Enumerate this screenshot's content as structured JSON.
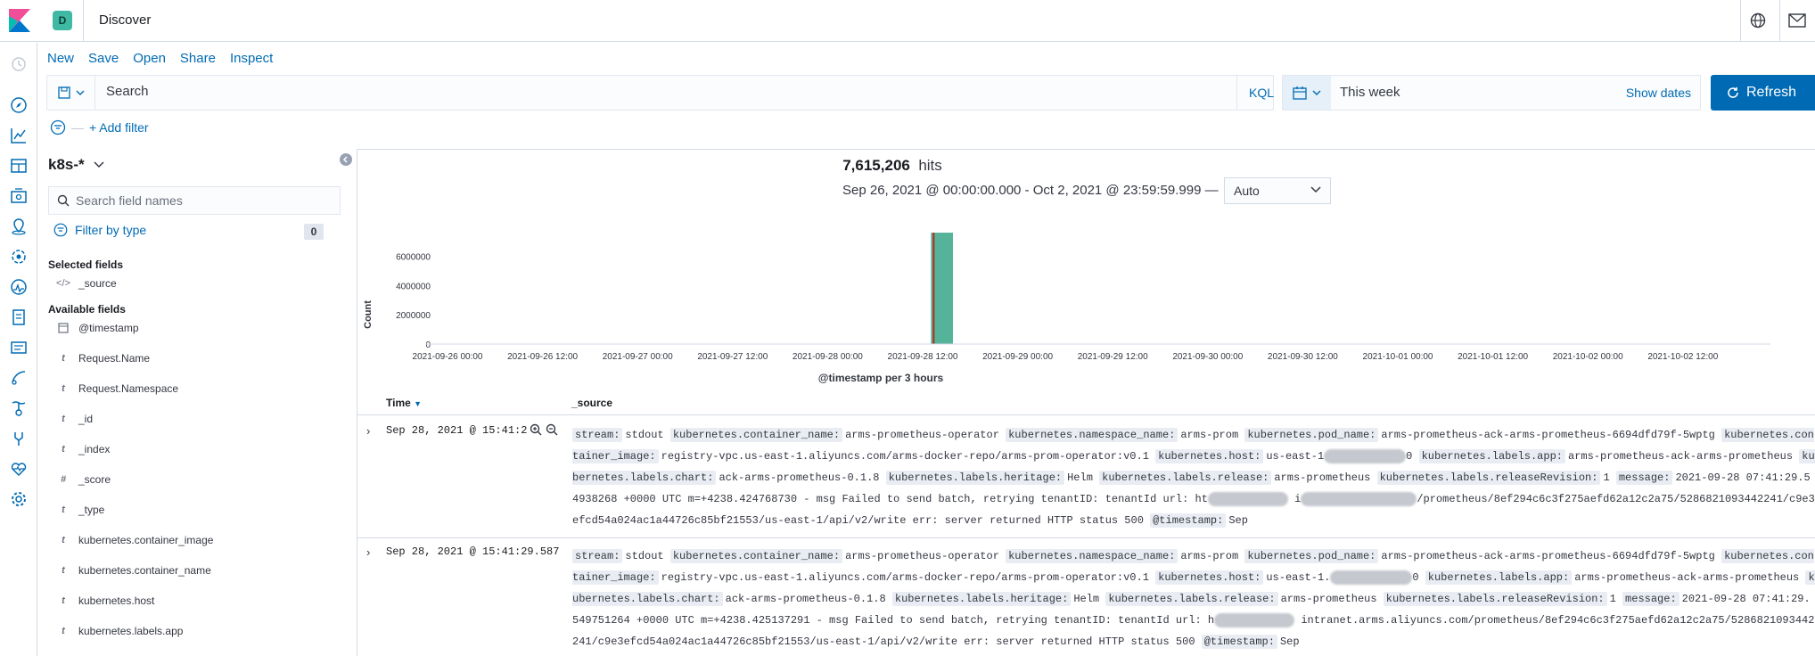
{
  "header": {
    "space_initial": "D",
    "app_title": "Discover",
    "logo_icon": "kibana-logo-icon",
    "help_icon": "help-globe-icon",
    "mail_icon": "mail-icon"
  },
  "nav": {
    "icons": [
      "recent-icon",
      "discover-icon",
      "visualize-icon",
      "dashboard-icon",
      "canvas-icon",
      "maps-icon",
      "ml-icon",
      "metrics-icon",
      "logs-icon",
      "apm-icon",
      "uptime-icon",
      "siem-icon",
      "dev-tools-icon",
      "monitoring-icon",
      "management-icon"
    ]
  },
  "topmenu": {
    "new": "New",
    "save": "Save",
    "open": "Open",
    "share": "Share",
    "inspect": "Inspect"
  },
  "query": {
    "placeholder": "Search",
    "language": "KQL"
  },
  "datepicker": {
    "value": "This week",
    "show_dates": "Show dates"
  },
  "refresh": {
    "label": "Refresh"
  },
  "filters": {
    "add_label": "+ Add filter"
  },
  "sidebar": {
    "index_pattern": "k8s-*",
    "search_placeholder": "Search field names",
    "filter_by_type": "Filter by type",
    "filter_count": "0",
    "selected_title": "Selected fields",
    "selected": [
      {
        "type": "</>",
        "name": "_source"
      }
    ],
    "available_title": "Available fields",
    "available": [
      {
        "type": "clock",
        "name": "@timestamp"
      },
      {
        "type": "t",
        "name": "Request.Name"
      },
      {
        "type": "t",
        "name": "Request.Namespace"
      },
      {
        "type": "t",
        "name": "_id"
      },
      {
        "type": "t",
        "name": "_index"
      },
      {
        "type": "#",
        "name": "_score"
      },
      {
        "type": "t",
        "name": "_type"
      },
      {
        "type": "t",
        "name": "kubernetes.container_image"
      },
      {
        "type": "t",
        "name": "kubernetes.container_name"
      },
      {
        "type": "t",
        "name": "kubernetes.host"
      },
      {
        "type": "t",
        "name": "kubernetes.labels.app"
      }
    ]
  },
  "main": {
    "hits_count": "7,615,206",
    "hits_label": "hits",
    "range": "Sep 26, 2021 @ 00:00:00.000 - Oct 2, 2021 @ 23:59:59.999 —",
    "interval": "Auto",
    "table_header": {
      "time": "Time",
      "source": "_source"
    }
  },
  "chart_data": {
    "type": "bar",
    "ylabel": "Count",
    "xlabel": "@timestamp per 3 hours",
    "yticks": [
      "6000000",
      "4000000",
      "2000000",
      "0"
    ],
    "ylim": [
      0,
      7800000
    ],
    "xticks": [
      "2021-09-26 00:00",
      "2021-09-26 12:00",
      "2021-09-27 00:00",
      "2021-09-27 12:00",
      "2021-09-28 00:00",
      "2021-09-28 12:00",
      "2021-09-29 00:00",
      "2021-09-29 12:00",
      "2021-09-30 00:00",
      "2021-09-30 12:00",
      "2021-10-01 00:00",
      "2021-10-01 12:00",
      "2021-10-02 00:00",
      "2021-10-02 12:00"
    ],
    "bars": [
      {
        "x": "2021-09-28 15:00",
        "value": 7615206
      }
    ],
    "bar_color": "#54b399",
    "marker_color": "#bd271e"
  },
  "rows": [
    {
      "time": "Sep 28, 2021 @ 15:41:29.549",
      "time_visible": "Sep 28, 2021 @ 15:41:2",
      "src": {
        "stream": "stdout",
        "container_name": "arms-prometheus-operator",
        "namespace_name": "arms-prom",
        "pod_name": "arms-prometheus-ack-arms-prometheus-6694dfd79f-5wptg",
        "container_image": "registry-vpc.us-east-1.aliyuncs.com/arms-docker-repo/arms-prom-operator:v0.1",
        "host": "us-east-1",
        "host_tail": "0",
        "labels_app": "arms-prometheus-ack-arms-prometheus",
        "labels_chart": "ack-arms-prometheus-0.1.8",
        "labels_heritage": "Helm",
        "labels_release": "arms-prometheus",
        "labels_release_revision": "1",
        "message": "2021-09-28 07:41:29.54938268 +0000 UTC m=+4238.424768730 - msg Failed to send batch, retrying tenantID: tenantId url: ht",
        "msg_tail": "/prometheus/8ef294c6c3f275aefd62a12c2a75/5286821093442241/c9e3efcd54a024ac1a44726c85bf21553/us-east-1/api/v2/write err: server returned HTTP status 500",
        "timestamp_tail": "Sep",
        "line_start": "i"
      }
    },
    {
      "time": "Sep 28, 2021 @ 15:41:29.587",
      "time_visible": "Sep 28, 2021 @ 15:41:29.587",
      "src": {
        "stream": "stdout",
        "container_name": "arms-prometheus-operator",
        "namespace_name": "arms-prom",
        "pod_name": "arms-prometheus-ack-arms-prometheus-6694dfd79f-5wptg",
        "container_image": "registry-vpc.us-east-1.aliyuncs.com/arms-docker-repo/arms-prom-operator:v0.1",
        "host": "us-east-1.",
        "host_tail": "0",
        "labels_app": "arms-prometheus-ack-arms-prometheus",
        "labels_chart": "ack-arms-prometheus-0.1.8",
        "labels_heritage": "Helm",
        "labels_release": "arms-prometheus",
        "labels_release_revision": "1",
        "message": "2021-09-28 07:41:29.549751264 +0000 UTC m=+4238.425137291 - msg Failed to send batch, retrying tenantID: tenantId url: h",
        "msg_tail": "intranet.arms.aliyuncs.com/prometheus/8ef294c6c3f275aefd62a12c2a75/5286821093442241/c9e3efcd54a024ac1a44726c85bf21553/us-east-1/api/v2/write err: server returned HTTP status 500",
        "timestamp_tail": "Sep",
        "line_start": ""
      }
    }
  ]
}
